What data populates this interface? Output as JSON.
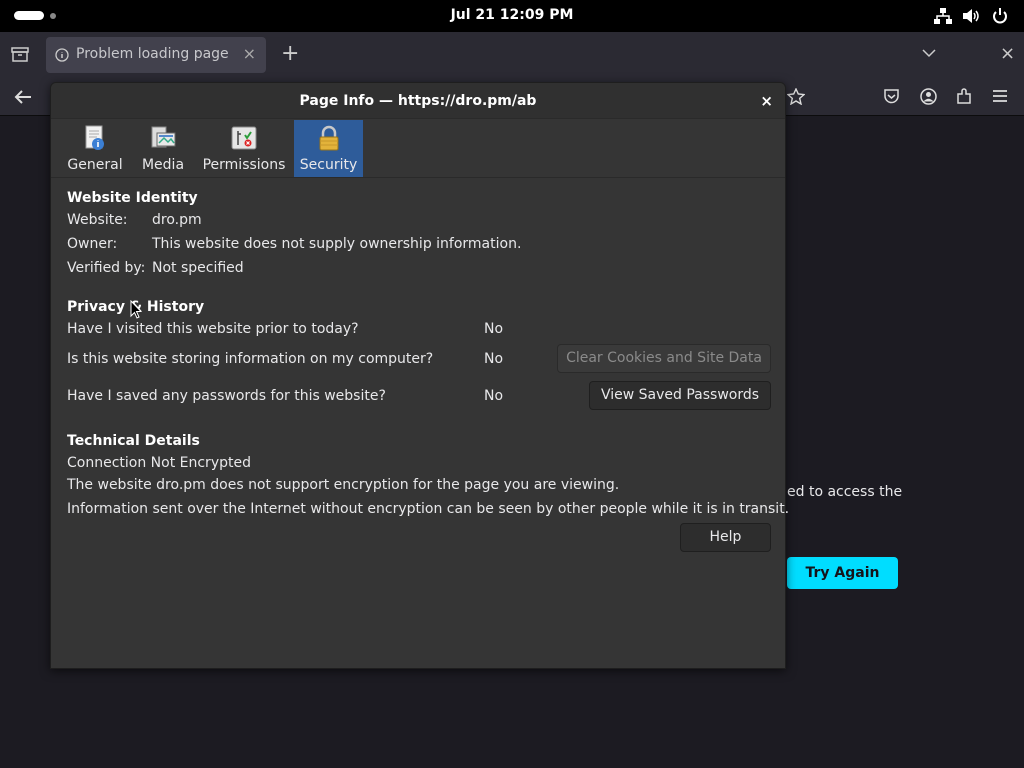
{
  "system_bar": {
    "clock": "Jul 21  12:09 PM"
  },
  "browser": {
    "tab_title": "Problem loading page",
    "error_fragment": "ed to access the",
    "try_again": "Try Again"
  },
  "dialog": {
    "title": "Page Info — https://dro.pm/ab",
    "close": "×",
    "tabs": [
      {
        "label": "General"
      },
      {
        "label": "Media"
      },
      {
        "label": "Permissions"
      },
      {
        "label": "Security",
        "active": true
      }
    ],
    "identity": {
      "heading": "Website Identity",
      "website_label": "Website:",
      "website_value": "dro.pm",
      "owner_label": "Owner:",
      "owner_value": "This website does not supply ownership information.",
      "verified_label": "Verified by:",
      "verified_value": "Not specified"
    },
    "privacy": {
      "heading": "Privacy & History",
      "q1": "Have I visited this website prior to today?",
      "a1": "No",
      "q2": "Is this website storing information on my computer?",
      "a2": "No",
      "q3": "Have I saved any passwords for this website?",
      "a3": "No",
      "clear_button": "Clear Cookies and Site Data",
      "view_button": "View Saved Passwords"
    },
    "technical": {
      "heading": "Technical Details",
      "line1": "Connection Not Encrypted",
      "line2": "The website dro.pm does not support encryption for the page you are viewing.",
      "line3": "Information sent over the Internet without encryption can be seen by other people while it is in transit."
    },
    "help_button": "Help"
  },
  "colors": {
    "accent": "#00ddff",
    "active_tab": "#2e5c9a",
    "dialog_bg": "#353535"
  }
}
